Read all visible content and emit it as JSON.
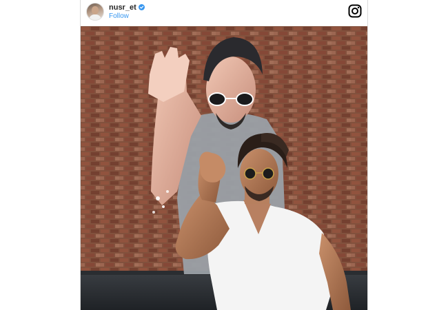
{
  "post": {
    "username": "nusr_et",
    "follow_label": "Follow",
    "verified": true
  },
  "icons": {
    "avatar": "profile-avatar",
    "verified": "verified-badge-icon",
    "brand": "instagram-icon"
  },
  "colors": {
    "follow_link": "#3897f0",
    "verified_badge": "#3897f0",
    "username": "#262626"
  }
}
